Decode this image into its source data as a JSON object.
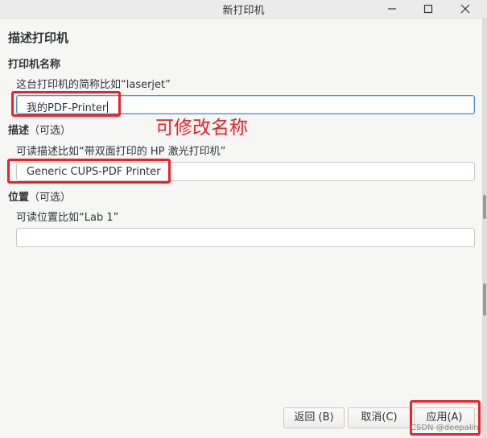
{
  "window": {
    "title": "新打印机"
  },
  "page": {
    "heading": "描述打印机"
  },
  "name_section": {
    "label": "打印机名称",
    "hint": "这台打印机的简称比如“laserjet”",
    "value": "我的PDF-Printer"
  },
  "description_section": {
    "label": "描述",
    "optional": "（可选）",
    "hint": "可读描述比如“带双面打印的 HP 激光打印机”",
    "value": "Generic CUPS-PDF Printer"
  },
  "location_section": {
    "label": "位置",
    "optional": "（可选）",
    "hint": "可读位置比如“Lab 1”",
    "value": ""
  },
  "annotation": {
    "text": "可修改名称",
    "color": "#e8212a"
  },
  "buttons": {
    "back": "返回 (B)",
    "cancel": "取消(C)",
    "apply": "应用(A)"
  },
  "watermark": "CSDN @deepalin",
  "colors": {
    "accent_red": "#e8212a",
    "focus_blue": "#4a90d9",
    "background": "#f6f6f5"
  }
}
